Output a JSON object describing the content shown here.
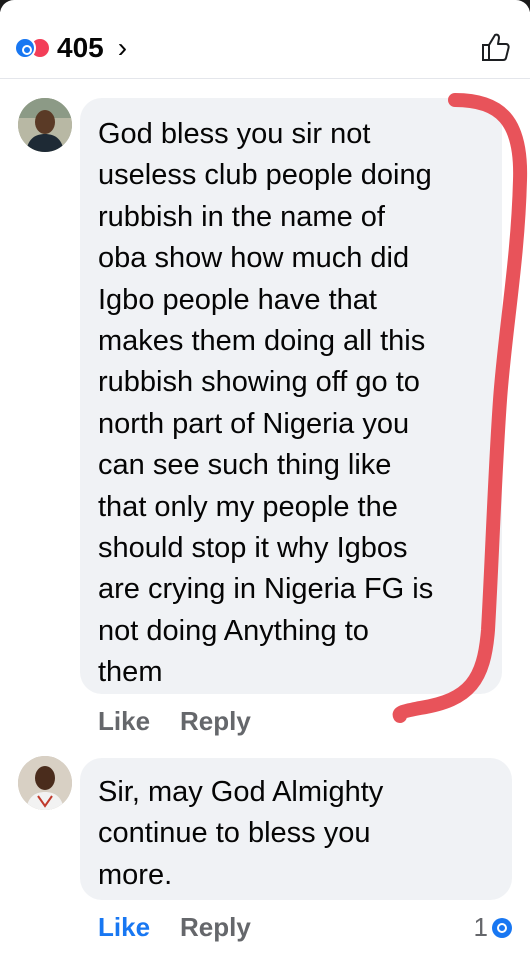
{
  "header": {
    "reactions": [
      "like",
      "love"
    ],
    "reaction_count": "405",
    "chevron": "›"
  },
  "comments": [
    {
      "text": "God bless you sir not\nuseless club  people doing\nrubbish in the name of\noba show how much did\nIgbo people have that\nmakes them doing all this\nrubbish showing off go to\nnorth part of Nigeria  you\ncan see  such thing like\nthat only  my people  the\nshould stop  it why Igbos\nare crying in Nigeria  FG is\nnot doing Anything to\nthem",
      "like_label": "Like",
      "reply_label": "Reply"
    },
    {
      "text": "Sir, may God Almighty\ncontinue to bless you\nmore.",
      "like_label": "Like",
      "reply_label": "Reply",
      "reaction_count": "1"
    }
  ],
  "colors": {
    "like_blue": "#1877f2",
    "love_red": "#f33e58",
    "bubble_bg": "#f0f2f5",
    "annotation_red": "#e8535a"
  }
}
